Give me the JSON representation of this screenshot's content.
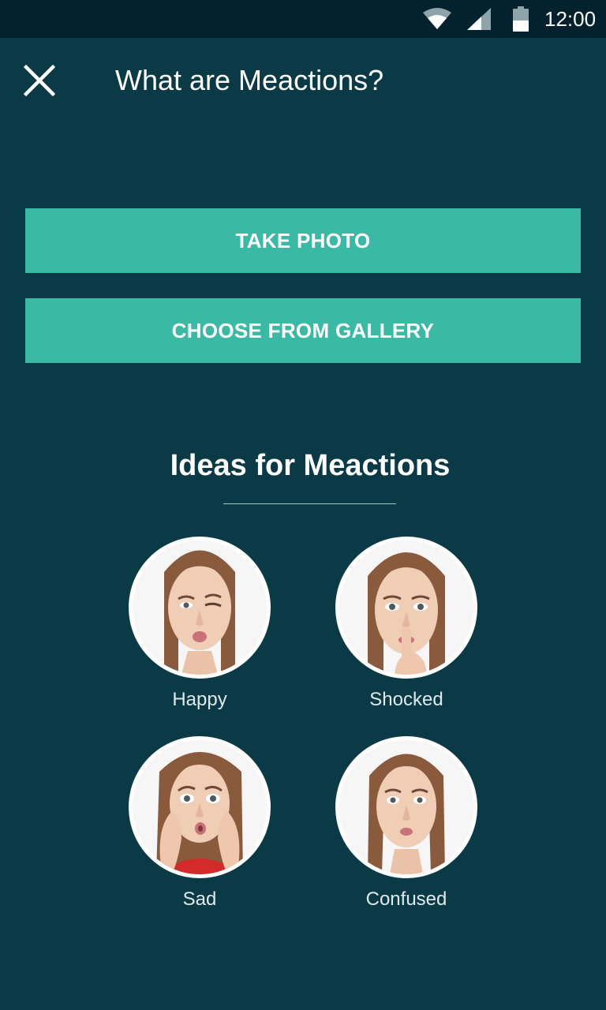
{
  "status_bar": {
    "time": "12:00",
    "icons": [
      "wifi-icon",
      "signal-icon",
      "battery-icon"
    ]
  },
  "app_bar": {
    "close_icon": "close-icon",
    "title": "What are Meactions?"
  },
  "actions": {
    "take_photo_label": "TAKE PHOTO",
    "gallery_label": "CHOOSE FROM GALLERY"
  },
  "ideas": {
    "title": "Ideas for Meactions",
    "items": [
      {
        "label": "Happy",
        "expression": "winking-pout-face"
      },
      {
        "label": "Shocked",
        "expression": "shush-finger-face"
      },
      {
        "label": "Sad",
        "expression": "hands-on-cheeks-face"
      },
      {
        "label": "Confused",
        "expression": "pursed-lips-face"
      }
    ]
  },
  "colors": {
    "background": "#0b3a47",
    "status_bar": "#04222e",
    "accent": "#3ab9a4",
    "text": "#ffffff"
  }
}
